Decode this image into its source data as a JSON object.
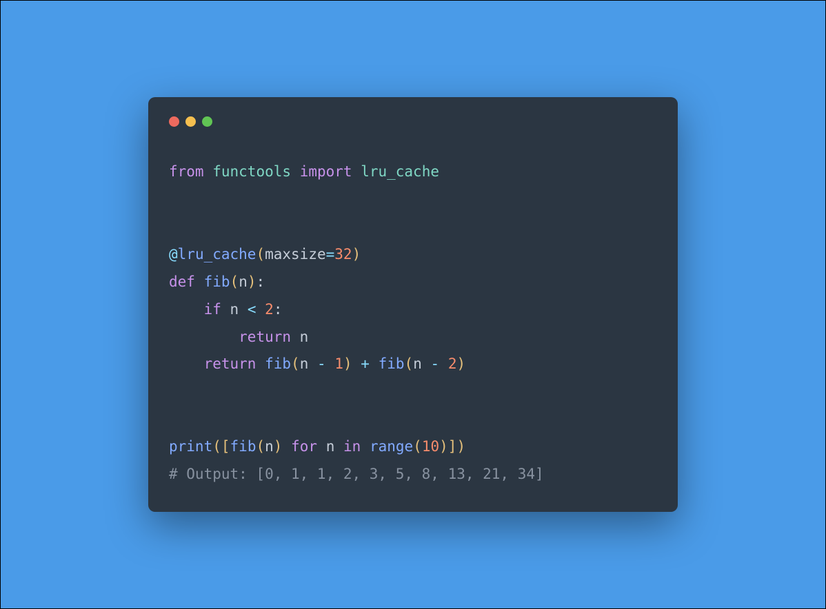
{
  "colors": {
    "background": "#4a9be8",
    "window": "#2b3642",
    "close": "#ed6a5e",
    "minimize": "#f5bf4f",
    "zoom": "#61c554",
    "keyword": "#c792ea",
    "function": "#82aaff",
    "name": "#7fd7c4",
    "number": "#f78c6c",
    "paren": "#e5c07b",
    "operator": "#89ddff",
    "comment": "#8892a0",
    "text": "#c5cdd8"
  },
  "code": {
    "kw_from": "from",
    "mod_functools": "functools",
    "kw_import": "import",
    "name_lru_cache": "lru_cache",
    "dec_at": "@",
    "dec_lru_cache": "lru_cache",
    "lp1": "(",
    "arg_maxsize": "maxsize",
    "eq1": "=",
    "num_32": "32",
    "rp1": ")",
    "kw_def": "def",
    "fn_fib_def": "fib",
    "lp2": "(",
    "param_n": "n",
    "rp2": ")",
    "colon1": ":",
    "kw_if": "if",
    "var_n1": "n",
    "op_lt": "<",
    "num_2a": "2",
    "colon2": ":",
    "kw_return1": "return",
    "var_n2": "n",
    "kw_return2": "return",
    "fn_fib1": "fib",
    "lp3": "(",
    "var_n3": "n",
    "op_minus1": "-",
    "num_1": "1",
    "rp3": ")",
    "op_plus": "+",
    "fn_fib2": "fib",
    "lp4": "(",
    "var_n4": "n",
    "op_minus2": "-",
    "num_2b": "2",
    "rp4": ")",
    "fn_print": "print",
    "lp5": "(",
    "lb1": "[",
    "fn_fib3": "fib",
    "lp6": "(",
    "var_n5": "n",
    "rp6": ")",
    "kw_for": "for",
    "var_n6": "n",
    "kw_in": "in",
    "fn_range": "range",
    "lp7": "(",
    "num_10": "10",
    "rp7": ")",
    "rb1": "]",
    "rp5": ")",
    "comment": "# Output: [0, 1, 1, 2, 3, 5, 8, 13, 21, 34]"
  }
}
